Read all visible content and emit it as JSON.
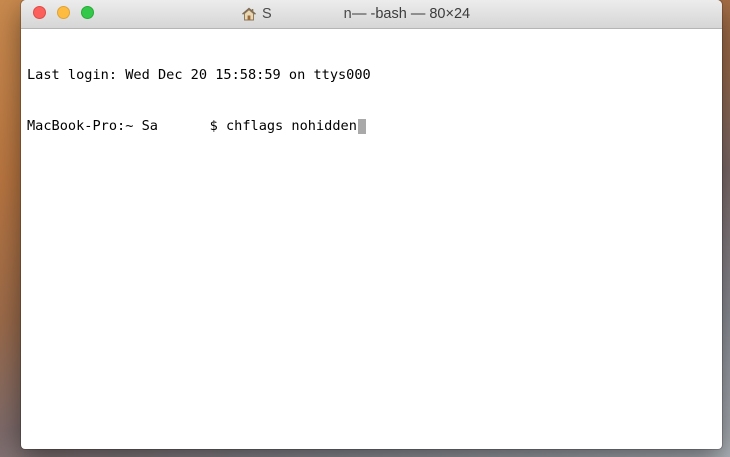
{
  "window": {
    "title_user_visible": "S",
    "title_user_tail": "n",
    "title_rest": " — -bash — 80×24",
    "home_icon": "house-icon"
  },
  "traffic_lights": {
    "close_color": "#fc605c",
    "minimize_color": "#fdbc40",
    "zoom_color": "#34c84a"
  },
  "terminal": {
    "last_login": "Last login: Wed Dec 20 15:58:59 on ttys000",
    "prompt_host": "MacBook-Pro:~ ",
    "prompt_user": "Sa",
    "prompt_symbol": "$ ",
    "command": "chflags nohidden"
  }
}
